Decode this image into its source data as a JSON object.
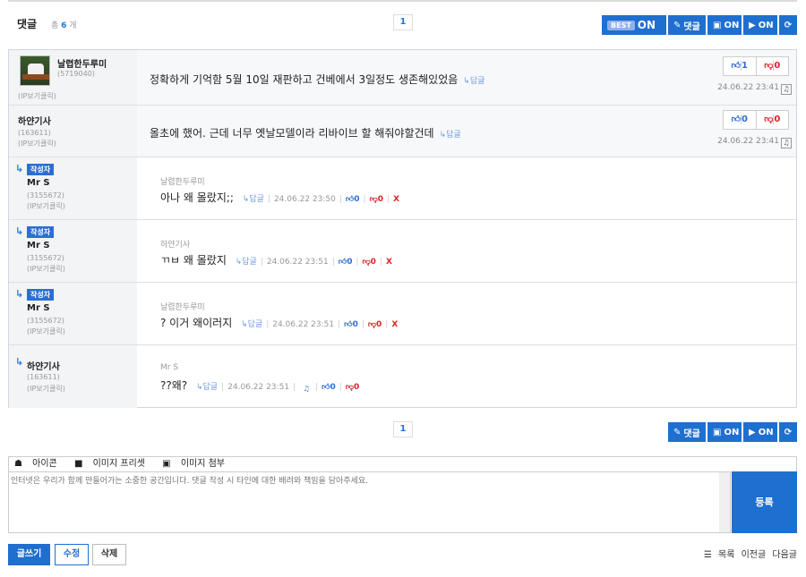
{
  "header": {
    "title": "댓글",
    "count_prefix": "총",
    "count": "6",
    "count_suffix": "개",
    "page": "1"
  },
  "toolbar": {
    "best_badge": "BEST",
    "best_on": "ON",
    "comment": "댓글",
    "image_on": "ON",
    "video_on": "ON"
  },
  "comments": [
    {
      "nick": "날렵한두루미",
      "id": "(5719040)",
      "ip": "(IP보기클릭)",
      "text": "정확하게 기억함 5월 10일 재판하고 건베에서 3일정도 생존해있었음",
      "reply_label": "↳답글",
      "up": "1",
      "down": "0",
      "date": "24.06.22 23:41"
    },
    {
      "nick": "하얀기사",
      "id": "(163611)",
      "ip": "(IP보기클릭)",
      "text": "올초에 했어. 근데 너무 옛날모델이라 리바이브 할 해줘야할건데",
      "reply_label": "↳답글",
      "up": "0",
      "down": "0",
      "date": "24.06.22 23:41"
    }
  ],
  "replies": [
    {
      "badge": "작성자",
      "nick": "Mr S",
      "id": "(3155672)",
      "ip": "(IP보기클릭)",
      "to": "날렵한두루미",
      "text": "아나 왜 몰랐지;;",
      "reply_label": "↳답글",
      "date": "24.06.22 23:50",
      "up": "0",
      "down": "0",
      "del": "X"
    },
    {
      "badge": "작성자",
      "nick": "Mr S",
      "id": "(3155672)",
      "ip": "(IP보기클릭)",
      "to": "하얀기사",
      "text": "ㄲㅂ 왜 몰랐지",
      "reply_label": "↳답글",
      "date": "24.06.22 23:51",
      "up": "0",
      "down": "0",
      "del": "X"
    },
    {
      "badge": "작성자",
      "nick": "Mr S",
      "id": "(3155672)",
      "ip": "(IP보기클릭)",
      "to": "날렵한두루미",
      "text": "? 이거 왜이러지",
      "reply_label": "↳답글",
      "date": "24.06.22 23:51",
      "up": "0",
      "down": "0",
      "del": "X"
    },
    {
      "nick": "하얀기사",
      "id": "(163611)",
      "ip": "(IP보기클릭)",
      "to": "Mr S",
      "text": "??왜?",
      "reply_label": "↳답글",
      "date": "24.06.22 23:51",
      "up": "0",
      "down": "0"
    }
  ],
  "editor": {
    "tool_icon": "아이콘",
    "tool_preset": "이미지 프리셋",
    "tool_attach": "이미지 첨부",
    "placeholder": "인터넷은 우리가 함께 만들어가는 소중한 공간입니다. 댓글 작성 시 타인에 대한 배려와 책임을 담아주세요.",
    "submit": "등록"
  },
  "actions": {
    "write": "글쓰기",
    "edit": "수정",
    "delete": "삭제",
    "list": "목록",
    "prev": "이전글",
    "next": "다음글"
  },
  "colors": {
    "accent": "#1f6fd0",
    "up": "#2d6ed4",
    "down": "#dd2222"
  }
}
